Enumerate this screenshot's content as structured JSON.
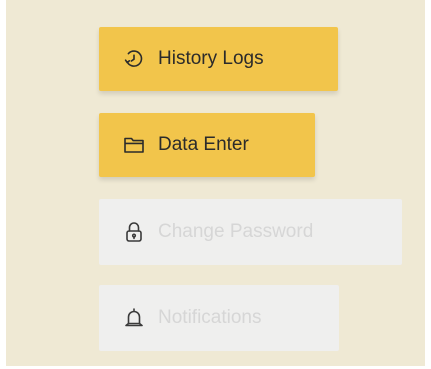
{
  "menu": {
    "items": [
      {
        "label": "History Logs",
        "icon": "history-icon",
        "state": "active"
      },
      {
        "label": "Data Enter",
        "icon": "folder-icon",
        "state": "active"
      },
      {
        "label": "Change Password",
        "icon": "lock-icon",
        "state": "disabled"
      },
      {
        "label": "Notifications",
        "icon": "bell-icon",
        "state": "disabled"
      }
    ]
  },
  "colors": {
    "panel_background": "#efe9d4",
    "active_button": "#f2c54b",
    "disabled_button": "#efefee",
    "active_text": "#2b2b2b",
    "disabled_text": "#d6d6d6"
  }
}
